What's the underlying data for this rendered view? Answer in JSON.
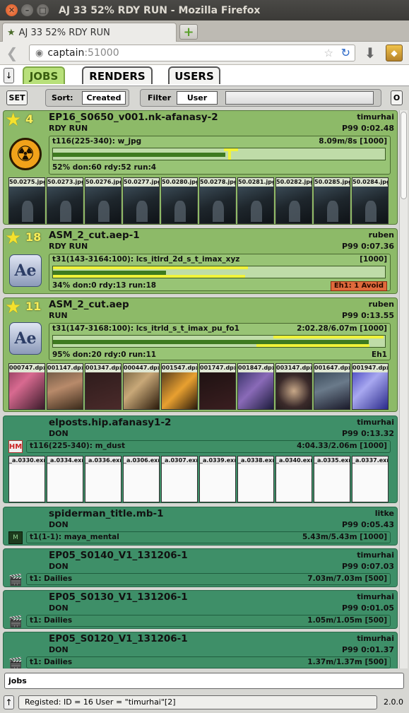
{
  "window": {
    "title": "AJ 33 52% RDY RUN - Mozilla Firefox"
  },
  "browser": {
    "tab_title": "AJ 33 52% RDY RUN",
    "url_host": "captain",
    "url_port": ":51000"
  },
  "app": {
    "tabs": [
      "JOBS",
      "RENDERS",
      "USERS"
    ],
    "set_label": "SET",
    "sort_label": "Sort:",
    "sort_value": "Created",
    "filter_label": "Filter",
    "filter_value": "User",
    "o_label": "O",
    "jobs": [
      {
        "name": "EP16_S0650_v001.nk-afanasy-2",
        "state": "RDY RUN",
        "user": "timurhai",
        "time": "P99 0:02.48",
        "priority": "4",
        "icon": "nuke-icon",
        "block": {
          "name": "t116(225-340): w_jpg",
          "info": "8.09m/8s [1000]",
          "stats": "52% don:60 rdy:52 run:4",
          "progress": 0.52
        },
        "thumbs": [
          "50.0275.jpg",
          "50.0273.jpg",
          "50.0276.jpg",
          "50.0277.jpg",
          "50.0280.jpg",
          "50.0278.jpg",
          "50.0281.jpg",
          "50.0282.jpg",
          "50.0285.jpg",
          "50.0284.jpg"
        ]
      },
      {
        "name": "ASM_2_cut.aep-1",
        "state": "RDY RUN",
        "user": "ruben",
        "time": "P99 0:07.36",
        "priority": "18",
        "icon": "after-effects-icon",
        "block": {
          "name": "t31(143-3164:100): lcs_itlrd_2d_s_t_imax_xyz",
          "info": "[1000]",
          "stats": "34% don:0 rdy:13 run:18",
          "progress": 0.34,
          "error": "Eh1: 1 Avoid"
        }
      },
      {
        "name": "ASM_2_cut.aep",
        "state": "RUN",
        "user": "ruben",
        "time": "P99 0:13.55",
        "priority": "11",
        "icon": "after-effects-icon",
        "block": {
          "name": "t31(147-3168:100): lcs_itrld_s_t_imax_pu_fo1",
          "info": "2:02.28/6.07m [1000]",
          "stats": "95% don:20 rdy:0 run:11",
          "progress": 0.95,
          "tag": "Eh1"
        },
        "thumbs": [
          "000747.dpx",
          "001147.dpx",
          "001347.dpx",
          "000447.dpx",
          "001547.dpx",
          "001747.dpx",
          "001847.dpx",
          "003147.dpx",
          "001647.dpx",
          "001947.dpx"
        ]
      },
      {
        "name": "elposts.hip.afanasy1-2",
        "state": "DON",
        "user": "timurhai",
        "time": "P99 0:13.32",
        "icon": "houdini-icon",
        "block": {
          "name": "t116(225-340): m_dust",
          "info": "4:04.33/2.06m [1000]"
        },
        "thumbs": [
          "_a.0330.exr",
          "_a.0334.exr",
          "_a.0336.exr",
          "_a.0306.exr",
          "_a.0307.exr",
          "_a.0339.exr",
          "_a.0338.exr",
          "_a.0340.exr",
          "_a.0335.exr",
          "_a.0337.exr"
        ]
      },
      {
        "name": "spiderman_title.mb-1",
        "state": "DON",
        "user": "litke",
        "time": "P99 0:05.43",
        "icon": "maya-icon",
        "block": {
          "name": "t1(1-1): maya_mental",
          "info": "5.43m/5.43m [1000]"
        }
      },
      {
        "name": "EP05_S0140_V1_131206-1",
        "state": "DON",
        "user": "timurhai",
        "time": "P99 0:07.03",
        "icon": "clapper-icon",
        "block": {
          "name": "t1: Dailies",
          "info": "7.03m/7.03m [500]"
        }
      },
      {
        "name": "EP05_S0130_V1_131206-1",
        "state": "DON",
        "user": "timurhai",
        "time": "P99 0:01.05",
        "icon": "clapper-icon",
        "block": {
          "name": "t1: Dailies",
          "info": "1.05m/1.05m [500]"
        }
      },
      {
        "name": "EP05_S0120_V1_131206-1",
        "state": "DON",
        "user": "timurhai",
        "time": "P99 0:01.37",
        "icon": "clapper-icon",
        "block": {
          "name": "t1: Dailies",
          "info": "1.37m/1.37m [500]"
        }
      }
    ],
    "cmd_value": "jobs",
    "info_text": "Registed: ID = 16 User = \"timurhai\"[2]",
    "version": "2.0.0"
  }
}
